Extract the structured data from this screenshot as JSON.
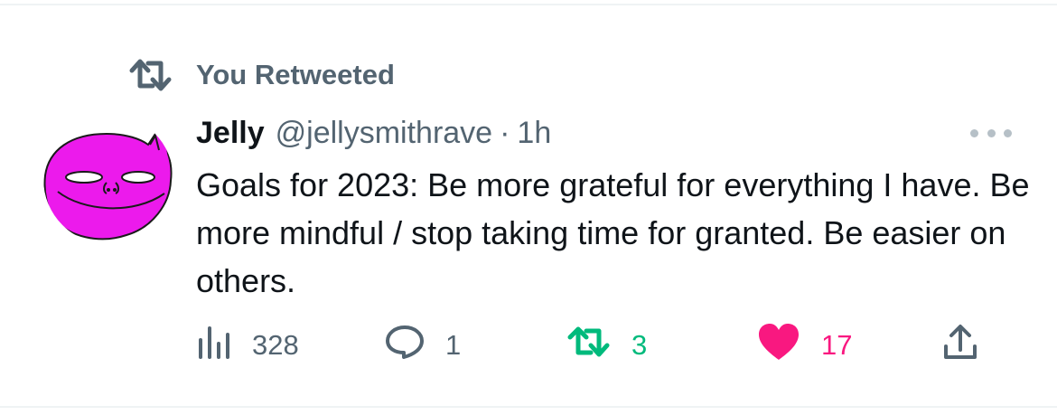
{
  "social_context": {
    "label": "You Retweeted"
  },
  "tweet": {
    "author_name": "Jelly",
    "author_handle": "@jellysmithrave",
    "separator": "·",
    "time": "1h",
    "text": "Goals for 2023: Be more grateful for everything I have. Be more mindful / stop taking time for granted. Be easier on others."
  },
  "actions": {
    "views": "328",
    "replies": "1",
    "retweets": "3",
    "likes": "17"
  },
  "icons": {
    "retweet": "retweet-icon",
    "views": "analytics-bars-icon",
    "reply": "speech-bubble-icon",
    "like": "heart-icon",
    "share": "share-upload-icon",
    "more": "ellipsis-icon"
  },
  "colors": {
    "text_primary": "#0f1419",
    "text_secondary": "#536471",
    "retweet_active": "#00ba7c",
    "like_active": "#f91880",
    "avatar_fill": "#ec1aec"
  }
}
